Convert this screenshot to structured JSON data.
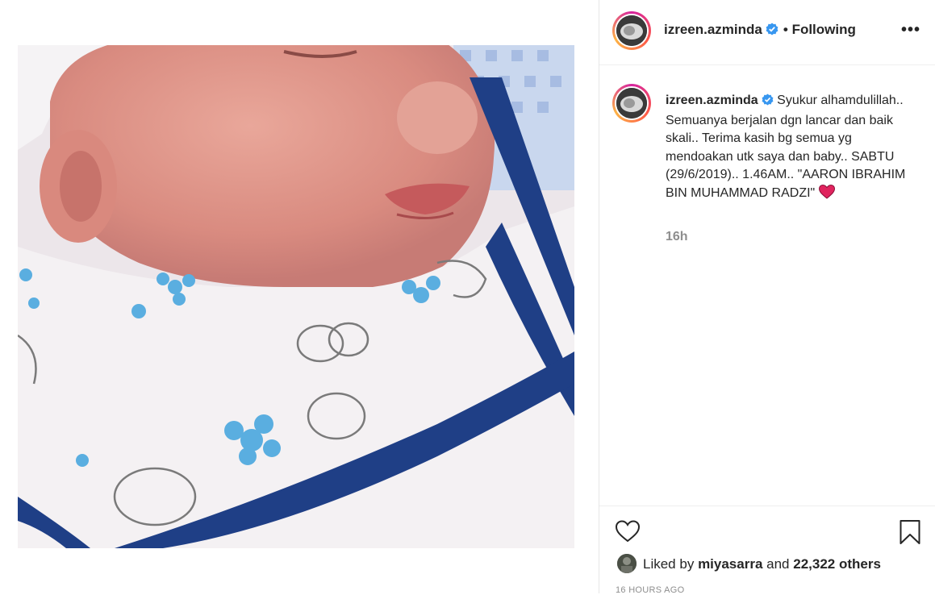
{
  "post": {
    "username": "izreen.azminda",
    "follow_status": "Following",
    "more_label": "•••",
    "caption": "Syukur alhamdulillah.. Semuanya berjalan dgn lancar dan baik skali.. Terima kasih bg semua yg mendoakan utk saya dan baby.. SABTU (29/6/2019).. 1.46AM.. \"AARON IBRAHIM BIN MUHAMMAD RADZI\"",
    "caption_time": "16h",
    "likes": {
      "prefix": "Liked by",
      "liker": "miyasarra",
      "and": "and",
      "count": "22,322 others"
    },
    "posted_ago": "16 HOURS AGO"
  },
  "icons": {
    "verified": "verified-badge-icon",
    "heart_emoji": "red-heart-icon",
    "like": "heart-outline-icon",
    "save": "bookmark-icon"
  },
  "colors": {
    "verified_blue": "#3897f0",
    "heart_red": "#e0245e",
    "ring_start": "#d6249f",
    "ring_end": "#fdb347"
  }
}
